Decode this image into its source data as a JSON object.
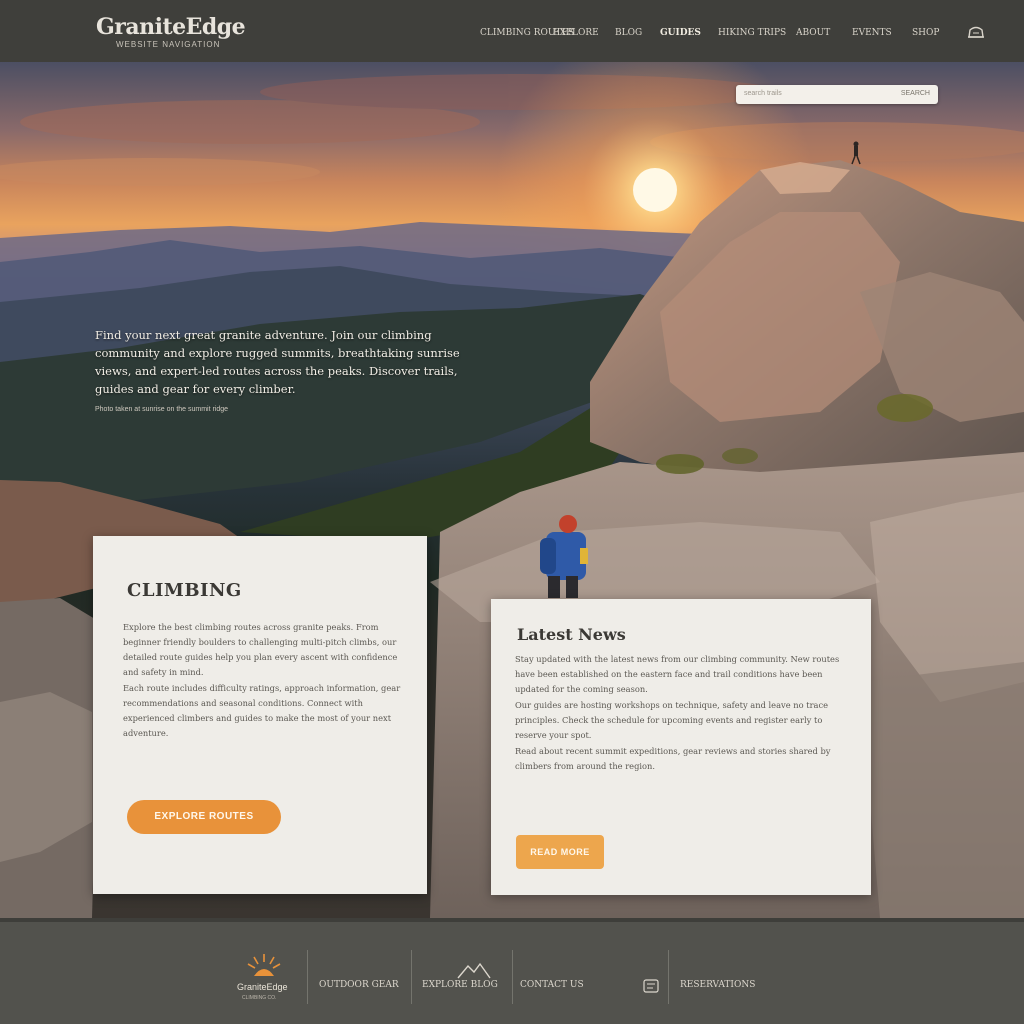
{
  "brand": {
    "name": "GraniteEdge",
    "tagline": "WEBSITE NAVIGATION"
  },
  "nav": {
    "items": [
      {
        "label": "CLIMBING ROUTES",
        "active": false
      },
      {
        "label": "EXPLORE",
        "active": false
      },
      {
        "label": "BLOG",
        "active": false
      },
      {
        "label": "GUIDES",
        "active": true
      },
      {
        "label": "HIKING TRIPS",
        "active": false
      },
      {
        "label": "ABOUT",
        "active": false
      },
      {
        "label": "EVENTS",
        "active": false
      },
      {
        "label": "SHOP",
        "active": false
      }
    ],
    "cart_icon": "backpack-icon"
  },
  "search": {
    "placeholder": "search trails",
    "button_label": "SEARCH"
  },
  "hero": {
    "intro": "Find your next great granite adventure. Join our climbing community and explore rugged summits, breathtaking sunrise views, and expert-led routes across the peaks. Discover trails, guides and gear for every climber.",
    "caption": "Photo taken at sunrise on the summit ridge"
  },
  "cards": {
    "left": {
      "title": "CLIMBING",
      "paragraphs": [
        "Explore the best climbing routes across granite peaks. From beginner friendly boulders to challenging multi-pitch climbs, our detailed route guides help you plan every ascent with confidence and safety in mind.",
        "Each route includes difficulty ratings, approach information, gear recommendations and seasonal conditions. Connect with experienced climbers and guides to make the most of your next adventure."
      ],
      "button_label": "EXPLORE ROUTES"
    },
    "right": {
      "title": "Latest News",
      "paragraphs": [
        "Stay updated with the latest news from our climbing community. New routes have been established on the eastern face and trail conditions have been updated for the coming season.",
        "Our guides are hosting workshops on technique, safety and leave no trace principles. Check the schedule for upcoming events and register early to reserve your spot.",
        "Read about recent summit expeditions, gear reviews and stories shared by climbers from around the region."
      ],
      "button_label": "READ MORE"
    }
  },
  "footer": {
    "logo_text": "GraniteEdge",
    "logo_sub": "CLIMBING CO.",
    "items": [
      {
        "label": "OUTDOOR GEAR",
        "icon": ""
      },
      {
        "label": "EXPLORE BLOG",
        "icon": "mountain-icon"
      },
      {
        "label": "CONTACT US",
        "icon": "phone-icon"
      },
      {
        "label": "RESERVATIONS",
        "icon": ""
      }
    ]
  },
  "colors": {
    "accent": "#e8923a",
    "header_bg": "#3f3f3b",
    "footer_bg": "#52524d",
    "card_bg": "#efede8"
  }
}
